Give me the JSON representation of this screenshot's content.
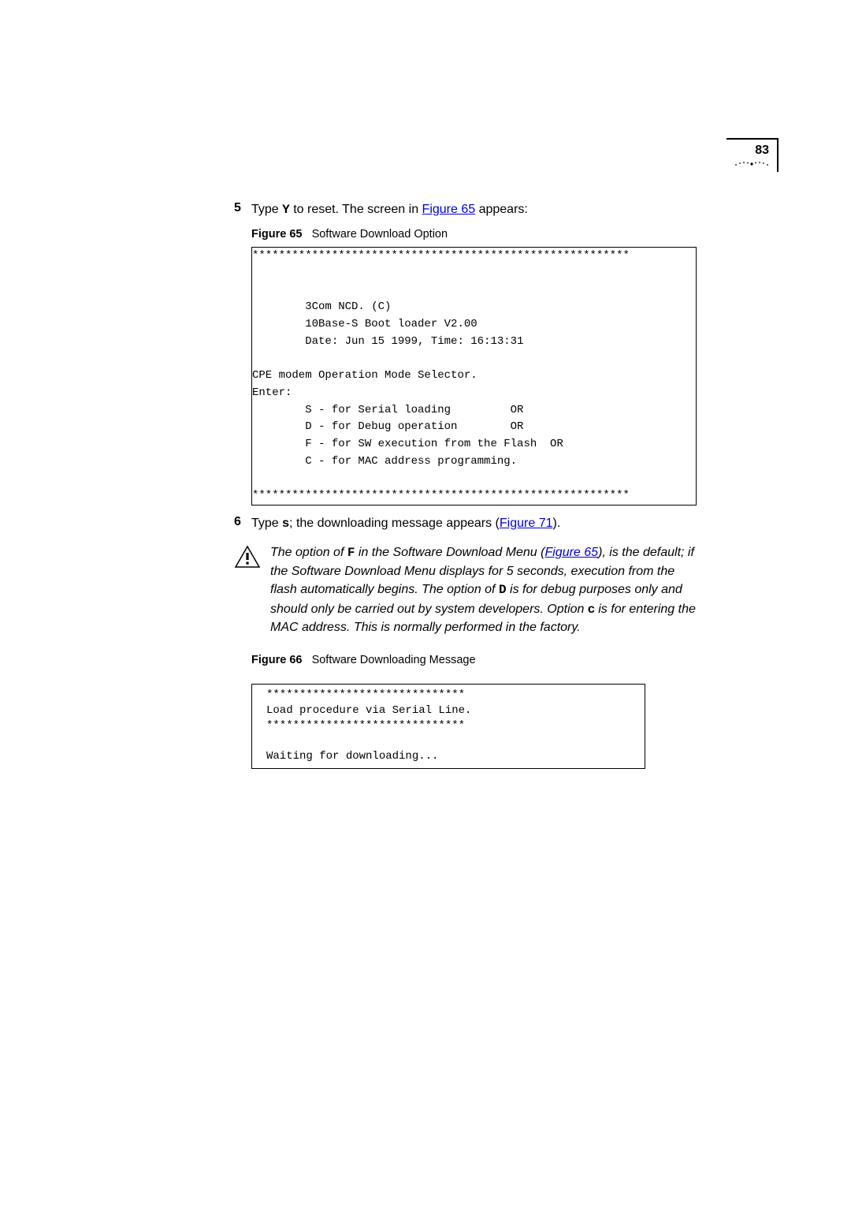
{
  "page_number": "83",
  "step5": {
    "num": "5",
    "prefix": "Type ",
    "key": "Y",
    "mid": " to reset. The screen in ",
    "link": "Figure 65",
    "suffix": " appears:"
  },
  "fig65": {
    "label": "Figure 65",
    "title": "Software Download Option",
    "lines": [
      "*********************************************************",
      "",
      "",
      "        3Com NCD. (C)",
      "        10Base-S Boot loader V2.00",
      "        Date: Jun 15 1999, Time: 16:13:31",
      "",
      "CPE modem Operation Mode Selector.",
      "Enter:",
      "        S - for Serial loading         OR",
      "        D - for Debug operation        OR",
      "        F - for SW execution from the Flash  OR",
      "        C - for MAC address programming.",
      "",
      "*********************************************************"
    ]
  },
  "step6": {
    "num": "6",
    "prefix": "Type ",
    "key": "s",
    "mid": "; the downloading message appears (",
    "link": "Figure 71",
    "suffix": ")."
  },
  "caution": {
    "t1": "The option of ",
    "k1": "F",
    "t2": " in the Software Download Menu (",
    "link1": "Figure 65",
    "t3": "), is the default; if the Software Download Menu displays for 5 seconds, execution from the flash automatically begins. The option of ",
    "k2": "D",
    "t4": " is for debug purposes only and should only be carried out by system developers. Option ",
    "k3": "c",
    "t5": " is for entering the MAC address. This is normally performed in the factory."
  },
  "fig66": {
    "label": "Figure 66",
    "title": "Software Downloading Message",
    "lines": [
      "******************************",
      "Load procedure via Serial Line.",
      "******************************",
      "",
      "Waiting for downloading..."
    ]
  }
}
